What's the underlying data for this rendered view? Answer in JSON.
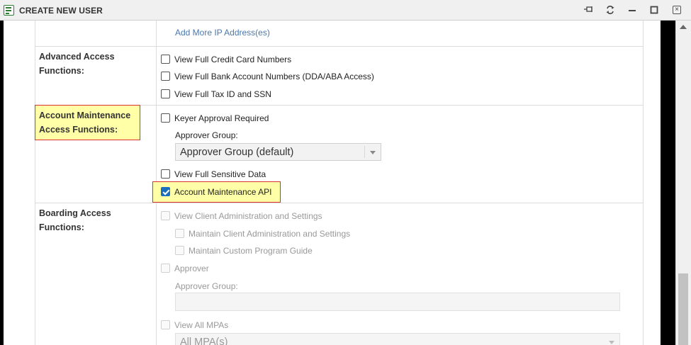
{
  "window": {
    "title": "CREATE NEW USER",
    "icons": [
      "form-window-icon",
      "pin-icon",
      "refresh-icon",
      "minimize-icon",
      "maximize-icon",
      "close-icon"
    ]
  },
  "ip_section": {
    "add_link": "Add More IP Address(es)"
  },
  "advanced": {
    "label": "Advanced Access Functions:",
    "options": [
      {
        "label": "View Full Credit Card Numbers",
        "checked": false
      },
      {
        "label": "View Full Bank Account Numbers (DDA/ABA Access)",
        "checked": false
      },
      {
        "label": "View Full Tax ID and SSN",
        "checked": false
      }
    ]
  },
  "account_maintenance": {
    "label_line1": "Account Maintenance",
    "label_line2": "Access Functions:",
    "keyer_approval": {
      "label": "Keyer Approval Required",
      "checked": false
    },
    "approver_group_label": "Approver Group:",
    "approver_group_value": "Approver Group (default)",
    "view_sensitive": {
      "label": "View Full Sensitive Data",
      "checked": false
    },
    "api": {
      "label": "Account Maintenance API",
      "checked": true
    },
    "highlight_color": "#ffffa8",
    "highlight_border": "#d93030"
  },
  "boarding": {
    "label": "Boarding Access Functions:",
    "view_client_admin": "View Client Administration and Settings",
    "maintain_client_admin": "Maintain Client Administration and Settings",
    "maintain_program_guide": "Maintain Custom Program Guide",
    "approver": "Approver",
    "approver_group_label": "Approver Group:",
    "approver_group_value": "",
    "view_all_mpas": "View All MPAs",
    "mpa_select_value": "All MPA(s)"
  },
  "colors": {
    "link": "#4a77ad",
    "checked": "#1a6dbf",
    "disabled_text": "#999999"
  }
}
